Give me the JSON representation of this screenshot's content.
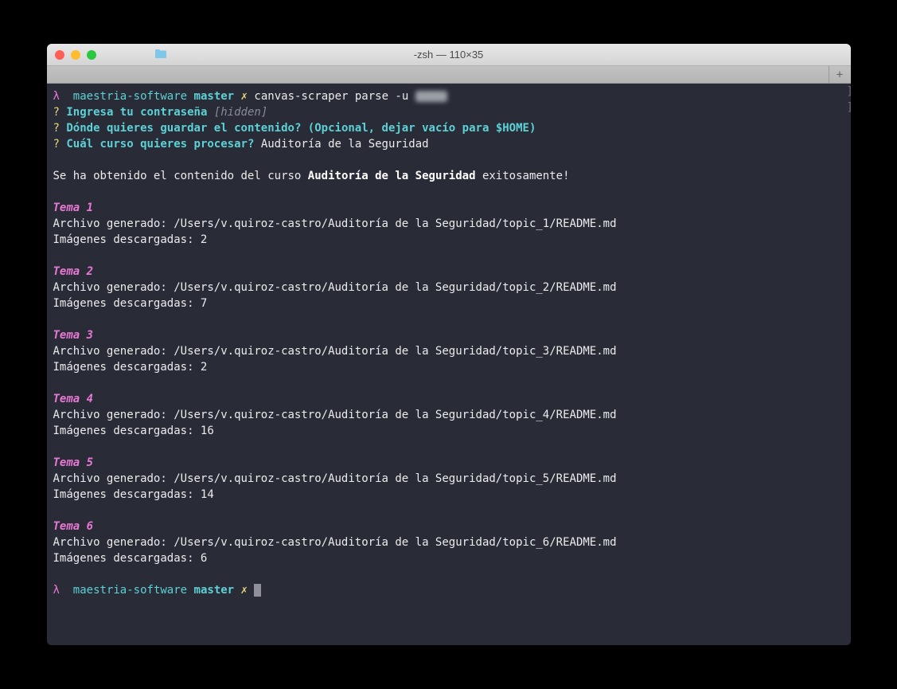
{
  "window": {
    "title": "-zsh — 110×35"
  },
  "prompt1": {
    "lambda": "λ",
    "dir": "maestria-software",
    "branch": "master",
    "symbol": "✗",
    "command": "canvas-scraper parse -u "
  },
  "q1": {
    "marker": "?",
    "text": "Ingresa tu contraseña",
    "hint": "[hidden]"
  },
  "q2": {
    "marker": "?",
    "text": "Dónde quieres guardar el contenido? (Opcional, dejar vacío para $HOME)"
  },
  "q3": {
    "marker": "?",
    "text": "Cuál curso quieres procesar?",
    "answer": "Auditoría de la Seguridad"
  },
  "success": {
    "prefix": "Se ha obtenido el contenido del curso ",
    "course": "Auditoría de la Seguridad",
    "suffix": " exitosamente!"
  },
  "topics": [
    {
      "title": "Tema 1",
      "file": "Archivo generado: /Users/v.quiroz-castro/Auditoría de la Seguridad/topic_1/README.md",
      "images": "Imágenes descargadas: 2"
    },
    {
      "title": "Tema 2",
      "file": "Archivo generado: /Users/v.quiroz-castro/Auditoría de la Seguridad/topic_2/README.md",
      "images": "Imágenes descargadas: 7"
    },
    {
      "title": "Tema 3",
      "file": "Archivo generado: /Users/v.quiroz-castro/Auditoría de la Seguridad/topic_3/README.md",
      "images": "Imágenes descargadas: 2"
    },
    {
      "title": "Tema 4",
      "file": "Archivo generado: /Users/v.quiroz-castro/Auditoría de la Seguridad/topic_4/README.md",
      "images": "Imágenes descargadas: 16"
    },
    {
      "title": "Tema 5",
      "file": "Archivo generado: /Users/v.quiroz-castro/Auditoría de la Seguridad/topic_5/README.md",
      "images": "Imágenes descargadas: 14"
    },
    {
      "title": "Tema 6",
      "file": "Archivo generado: /Users/v.quiroz-castro/Auditoría de la Seguridad/topic_6/README.md",
      "images": "Imágenes descargadas: 6"
    }
  ],
  "prompt2": {
    "lambda": "λ",
    "dir": "maestria-software",
    "branch": "master",
    "symbol": "✗"
  },
  "scroll": {
    "a": "]",
    "b": "]"
  }
}
